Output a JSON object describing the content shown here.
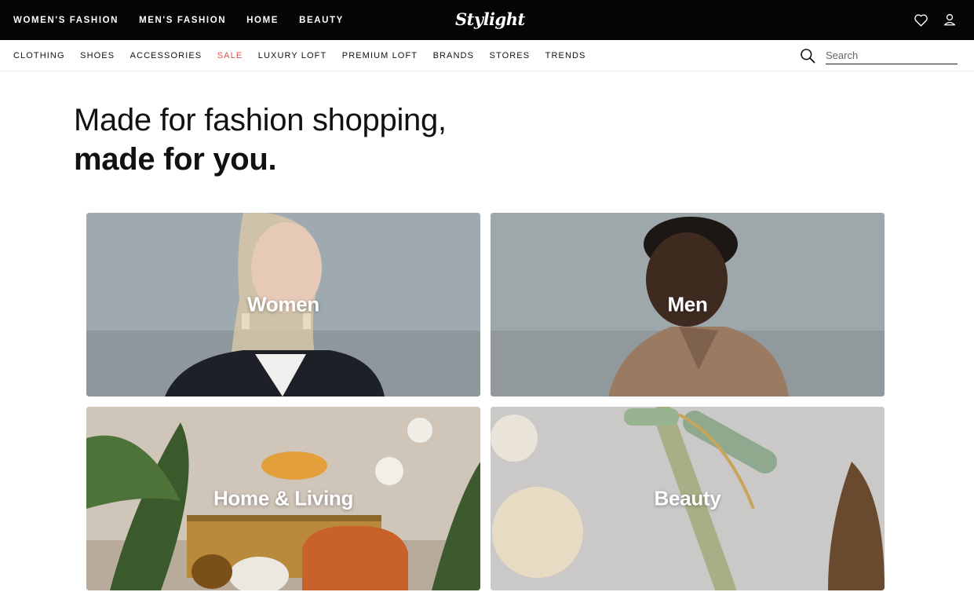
{
  "top_nav": {
    "items": [
      "WOMEN'S FASHION",
      "MEN'S FASHION",
      "HOME",
      "BEAUTY"
    ],
    "logo": "Stylight",
    "icons": [
      "heart-icon",
      "user-icon"
    ]
  },
  "sub_nav": {
    "items": [
      "CLOTHING",
      "SHOES",
      "ACCESSORIES",
      "SALE",
      "LUXURY LOFT",
      "PREMIUM LOFT",
      "BRANDS",
      "STORES",
      "TRENDS"
    ],
    "sale_color": "#d9534f",
    "search": {
      "placeholder": "Search",
      "value": ""
    }
  },
  "hero": {
    "line1": "Made for fashion shopping,",
    "line2": "made for you."
  },
  "categories": [
    {
      "label": "Women"
    },
    {
      "label": "Men"
    },
    {
      "label": "Home & Living"
    },
    {
      "label": "Beauty"
    }
  ],
  "colors": {
    "topbar": "#050505",
    "text": "#111111",
    "accent_sale": "#d9534f"
  }
}
